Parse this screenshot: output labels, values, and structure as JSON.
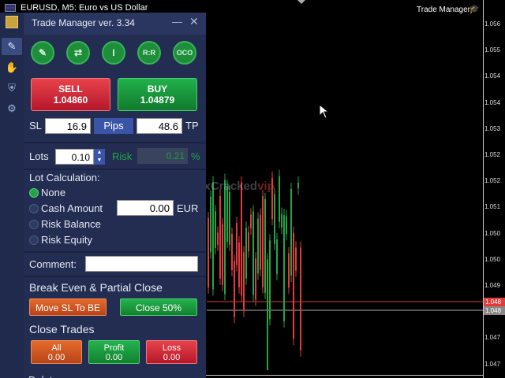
{
  "chart": {
    "title": "EURUSD, M5:  Euro vs US Dollar",
    "trade_manager_label": "Trade Manager",
    "watermark_prefix": "ForexCracked",
    "watermark_suffix": "vip",
    "price_ticks": [
      "1.056",
      "1.055",
      "1.054",
      "1.054",
      "1.053",
      "1.052",
      "1.052",
      "1.051",
      "1.050",
      "1.050",
      "1.049",
      "1.048",
      "1.047",
      "1.047"
    ],
    "ask_tag": "1.048",
    "bid_tag": "1.048",
    "colors": {
      "bull": "#22a447",
      "bear": "#e23b3b",
      "ask_line": "#e23b3b",
      "bid_line": "#aaaaaa"
    }
  },
  "sidebar": {
    "items": [
      {
        "icon": "edit-icon"
      },
      {
        "icon": "hand-icon"
      },
      {
        "icon": "shield-icon"
      },
      {
        "icon": "gear-icon"
      }
    ]
  },
  "panel": {
    "title": "Trade Manager ver. 3.34",
    "minimize": "—",
    "close": "✕",
    "tools": [
      {
        "icon": "pencil-icon",
        "label": "✎"
      },
      {
        "icon": "swap-icon",
        "label": "⇄"
      },
      {
        "icon": "text-cursor-icon",
        "label": "I"
      },
      {
        "icon": "rr-icon",
        "label": "R:R"
      },
      {
        "icon": "oco-icon",
        "label": "OCO"
      }
    ],
    "sell": {
      "label": "SELL",
      "price": "1.04860"
    },
    "buy": {
      "label": "BUY",
      "price": "1.04879"
    },
    "sl_label": "SL",
    "sl_value": "16.9",
    "pips_label": "Pips",
    "tp_value": "48.6",
    "tp_label": "TP",
    "lots_label": "Lots",
    "lots_value": "0.10",
    "risk_label": "Risk",
    "risk_value": "0.21",
    "pct_label": "%",
    "lot_calc_label": "Lot Calculation:",
    "lot_options": [
      {
        "label": "None",
        "selected": true
      },
      {
        "label": "Cash Amount",
        "selected": false
      },
      {
        "label": "Risk Balance",
        "selected": false
      },
      {
        "label": "Risk Equity",
        "selected": false
      }
    ],
    "cash_value": "0.00",
    "cash_currency": "EUR",
    "comment_label": "Comment:",
    "comment_value": "",
    "be_title": "Break Even & Partial Close",
    "move_sl_label": "Move SL To BE",
    "close50_label": "Close 50%",
    "close_trades_title": "Close Trades",
    "close_all": {
      "label": "All",
      "value": "0.00"
    },
    "close_profit": {
      "label": "Profit",
      "value": "0.00"
    },
    "close_loss": {
      "label": "Loss",
      "value": "0.00"
    },
    "cutoff_label": "Delete Orders"
  }
}
